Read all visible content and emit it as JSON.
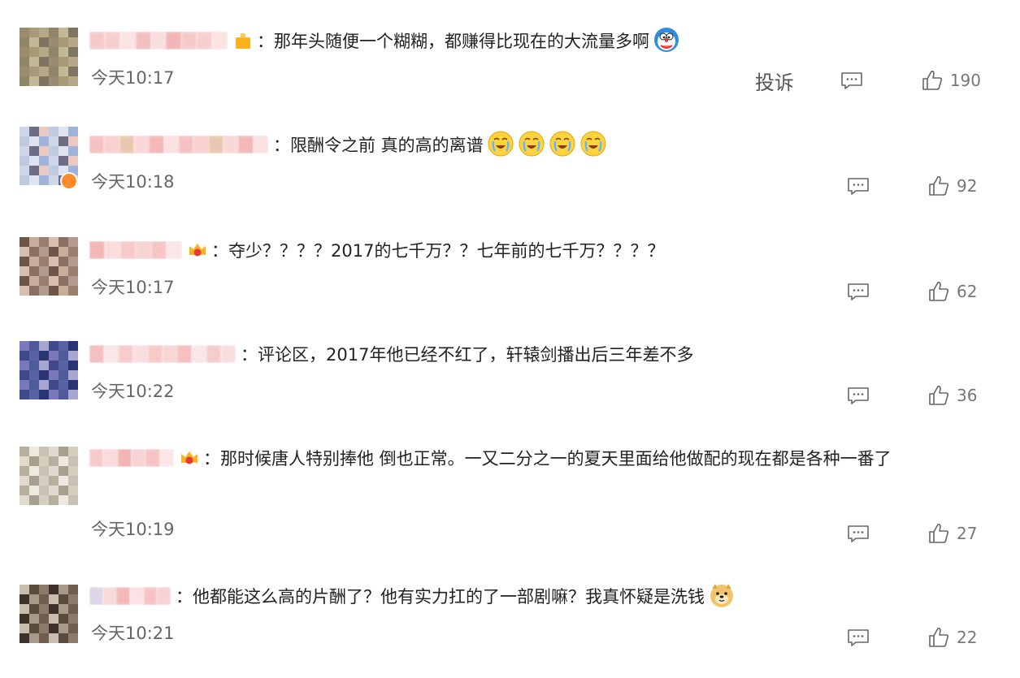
{
  "comments": [
    {
      "text": "：那年头随便一个糊糊，都赚得比现在的大流量多啊",
      "time": "今天10:17",
      "likes": "190",
      "report_label": "投诉",
      "emoji": "doraemon-sticker",
      "avatar_colors": [
        "#9a8c6e",
        "#a89a76",
        "#b7a889",
        "#8f8568",
        "#c4b796",
        "#7e7560"
      ],
      "name_colors": [
        "#f6c9c9",
        "#f3b6b6",
        "#f9dede",
        "#f2c0c0",
        "#fbe3e3",
        "#f7cfcf"
      ],
      "medal": "gold-badge-icon"
    },
    {
      "text": "：限酬令之前 真的高的离谱",
      "time": "今天10:18",
      "likes": "92",
      "emoji": "laugh-cry-emoji",
      "avatar_colors": [
        "#9fb3d8",
        "#cfd6e8",
        "#6d6d86",
        "#e9c9c0",
        "#bfc9e2",
        "#dfe3ef"
      ],
      "name_colors": [
        "#f8d0d0",
        "#f6c1c1",
        "#fae0e0",
        "#f4b8b8",
        "#f9d8d8",
        "#e9c7b0"
      ],
      "medal": ""
    },
    {
      "text": "：夺少？？？？2017的七千万？？七年前的七千万？？？？",
      "time": "今天10:17",
      "likes": "62",
      "emoji": "",
      "avatar_colors": [
        "#8a6f62",
        "#b39a8e",
        "#6e5548",
        "#c9ad9b",
        "#9a7f70",
        "#d7beae"
      ],
      "name_colors": [
        "#f7caca",
        "#f9dcdc",
        "#f3b7b7",
        "#fae6e6",
        "#f6c6c6",
        "#f8d3d3"
      ],
      "medal": "crown-badge-icon"
    },
    {
      "text": "：评论区，2017年他已经不红了，轩辕剑播出后三年差不多",
      "time": "今天10:22",
      "likes": "36",
      "emoji": "",
      "avatar_colors": [
        "#3e4a8a",
        "#5a62a6",
        "#2b3472",
        "#7a78b8",
        "#4f5a98",
        "#a6a6d0"
      ],
      "name_colors": [
        "#f9dede",
        "#f6cccc",
        "#fae6e6",
        "#f4c0c0",
        "#f8d6d6",
        "#f7caca"
      ],
      "medal": ""
    },
    {
      "text": "：那时候唐人特别捧他 倒也正常。一又二分之一的夏天里面给他做配的现在都是各种一番了",
      "time": "今天10:19",
      "likes": "27",
      "emoji": "",
      "avatar_colors": [
        "#c9c2b4",
        "#e1dbcf",
        "#a8a08f",
        "#d6cfc0",
        "#b7af9e",
        "#efeae0"
      ],
      "name_colors": [
        "#f6c4c4",
        "#f8d4d4",
        "#f3b5b5",
        "#f9dcdc",
        "#f7caca",
        "#fbe6e6"
      ],
      "medal": "crown-badge-icon"
    },
    {
      "text": "：他都能这么高的片酬了？他有实力扛的了一部剧嘛？我真怀疑是洗钱",
      "time": "今天10:21",
      "likes": "22",
      "emoji": "doge-emoji",
      "avatar_colors": [
        "#5b4a3e",
        "#8c7a6a",
        "#3d3029",
        "#a8998a",
        "#6f5e50",
        "#c9bdb0"
      ],
      "name_colors": [
        "#f8d2d2",
        "#f6c2c2",
        "#fae2e2",
        "#f3b9b9",
        "#f9dada",
        "#dcd6e8"
      ],
      "medal": ""
    }
  ]
}
